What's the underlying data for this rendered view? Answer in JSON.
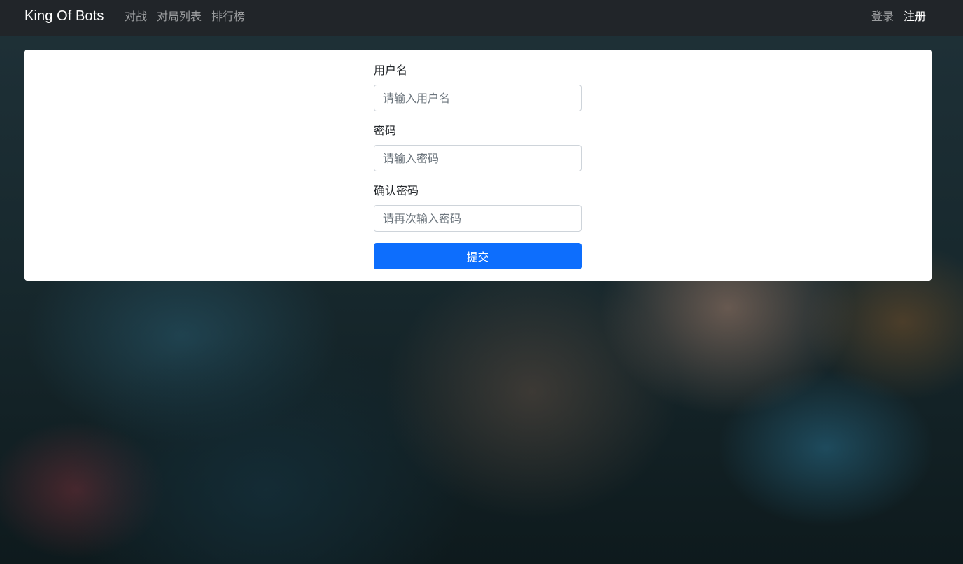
{
  "navbar": {
    "brand": "King Of Bots",
    "left_links": [
      {
        "label": "对战"
      },
      {
        "label": "对局列表"
      },
      {
        "label": "排行榜"
      }
    ],
    "right_links": [
      {
        "label": "登录"
      },
      {
        "label": "注册"
      }
    ]
  },
  "form": {
    "username": {
      "label": "用户名",
      "placeholder": "请输入用户名",
      "value": ""
    },
    "password": {
      "label": "密码",
      "placeholder": "请输入密码",
      "value": ""
    },
    "confirm_password": {
      "label": "确认密码",
      "placeholder": "请再次输入密码",
      "value": ""
    },
    "submit_label": "提交"
  },
  "colors": {
    "navbar_bg": "#212529",
    "primary": "#0d6efd",
    "card_bg": "#ffffff"
  }
}
